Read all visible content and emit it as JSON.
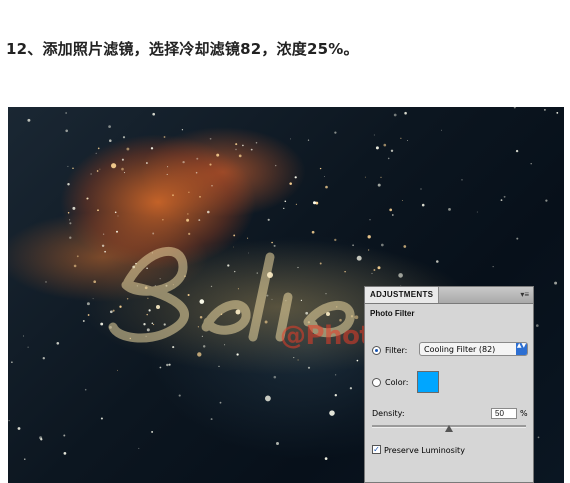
{
  "instruction": "12、添加照片滤镜，选择冷却滤镜82，浓度25%。",
  "watermark": "@Photoshop大师",
  "panel": {
    "tab": "ADJUSTMENTS",
    "menu_icon": "▾≡",
    "title": "Photo Filter",
    "filter_label": "Filter:",
    "filter_value": "Cooling Filter (82)",
    "color_label": "Color:",
    "color_swatch": "#00a6ff",
    "density_label": "Density:",
    "density_value": "50",
    "density_unit": "%",
    "density_level": 0.5,
    "preserve_label": "Preserve Luminosity",
    "preserve_checked": true,
    "check_mark": "✓",
    "select_arrows": "▲▼"
  },
  "colors": {
    "accent": "#2d6fd2",
    "panel_bg": "#d6d6d6"
  }
}
